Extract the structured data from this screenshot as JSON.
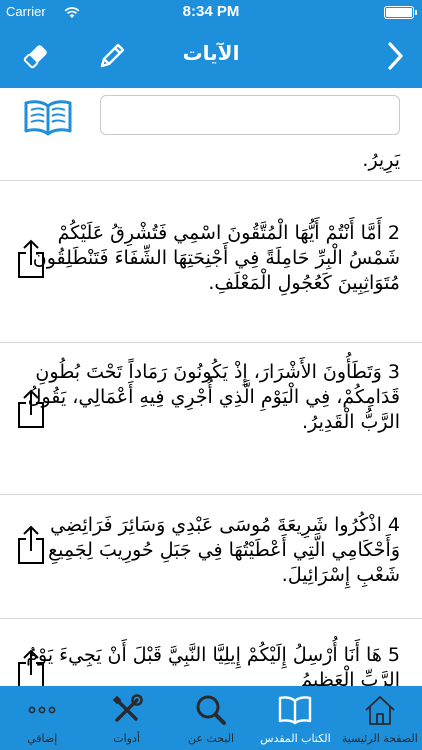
{
  "status": {
    "carrier": "Carrier",
    "time": "8:34 PM"
  },
  "nav": {
    "title": "الآيات"
  },
  "search": {
    "value": "",
    "placeholder": ""
  },
  "partial_top_text": "يَرِيرُ.",
  "verses": [
    {
      "text": "2 أَمَّا أَنْتُمْ أَيُّهَا الْمُتَّقُونَ اسْمِي فَتُشْرِقُ عَلَيْكُمْ شَمْسُ الْبِرِّ حَامِلَةً فِي أَجْنِحَتِهَا الشِّفَاءَ فَتَنْطَلِقُونَ مُتَوَاثِبِينَ كَعُجُولِ الْمَعْلَفِ."
    },
    {
      "text": "3 وَتَطَأُونَ الأَشْرَارَ، إِذْ يَكُونُونَ رَمَاداً تَحْتَ بُطُونِ قَدَامِكُمْ، فِي الْيَوْمِ الَّذِي أُجْرِي فِيهِ أَعْمَالِي، يَقُولُ الرَّبُّ الْقَدِيرُ."
    },
    {
      "text": "4 اذْكُرُوا شَرِيعَةَ مُوسَى عَبْدِي وَسَائِرَ فَرَائِضِي وَأَحْكَامِي الَّتِي أَعْطَيْتُهَا فِي جَبَلِ حُورِيبَ لِجَمِيعِ شَعْبِ إِسْرَائِيلَ."
    },
    {
      "text": "5 هَا أَنَا أُرْسِلُ إِلَيْكُمْ إِيلِيَّا النَّبِيَّ قَبْلَ أَنْ يَجِيءَ يَوْمُ الرَّبِّ الْعَظِيمُ"
    }
  ],
  "tabs": [
    {
      "label": "إضافي",
      "icon": "more-dots-icon"
    },
    {
      "label": "أدوات",
      "icon": "tools-icon"
    },
    {
      "label": "البحث عن",
      "icon": "search-icon"
    },
    {
      "label": "الكتاب المقدس",
      "icon": "open-book-icon"
    },
    {
      "label": "الصفحة الرئيسية",
      "icon": "home-icon"
    }
  ],
  "colors": {
    "primary": "#1e8fda",
    "tab_inactive": "#2a2a2a",
    "tab_active": "#ffffff"
  }
}
